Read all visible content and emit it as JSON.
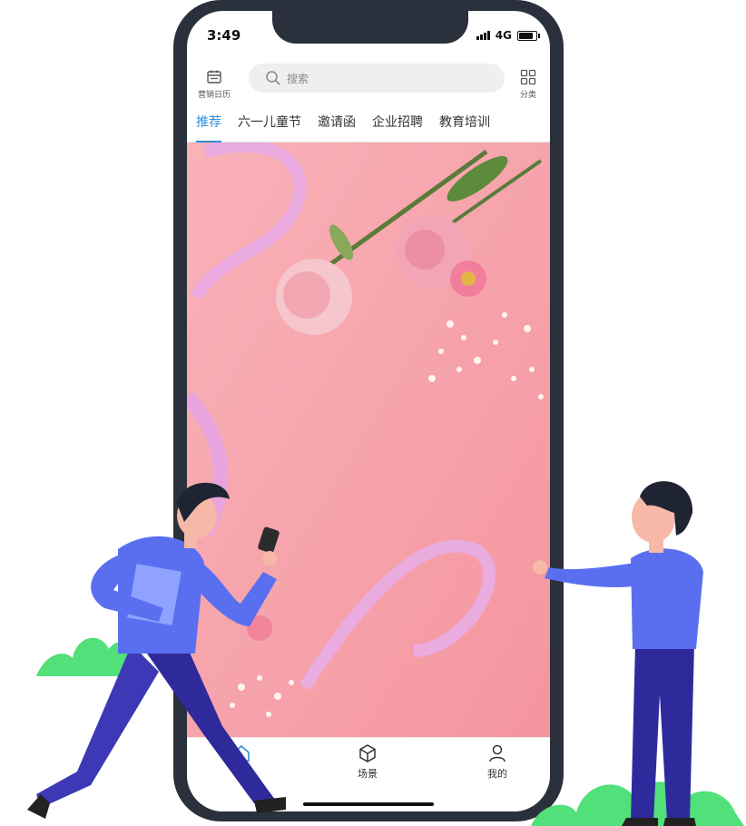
{
  "status_bar": {
    "time": "3:49",
    "network": "4G"
  },
  "header": {
    "calendar_label": "营销日历",
    "search_placeholder": "搜索",
    "category_label": "分类"
  },
  "tabs": [
    {
      "label": "推荐",
      "active": true
    },
    {
      "label": "六一儿童节",
      "active": false
    },
    {
      "label": "邀请函",
      "active": false
    },
    {
      "label": "企业招聘",
      "active": false
    },
    {
      "label": "教育培训",
      "active": false
    }
  ],
  "bottom_nav": [
    {
      "label": "首页",
      "icon": "home-icon"
    },
    {
      "label": "场景",
      "icon": "cube-icon"
    },
    {
      "label": "我的",
      "icon": "user-icon"
    }
  ],
  "colors": {
    "phone_frame": "#2a313c",
    "accent": "#2f8ed8",
    "banner_pink": "#f7a3ac",
    "figure_shirt": "#5a6ff0",
    "figure_pants": "#2e2a9c",
    "bush_green": "#52e07a"
  }
}
